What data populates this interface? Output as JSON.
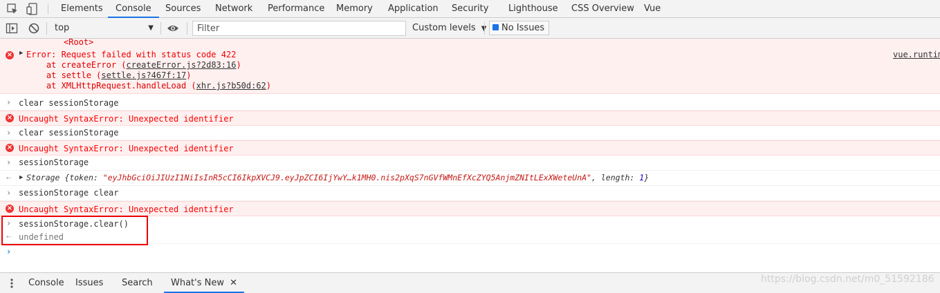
{
  "tabs": [
    {
      "label": "Elements",
      "active": false
    },
    {
      "label": "Console",
      "active": true
    },
    {
      "label": "Sources",
      "active": false
    },
    {
      "label": "Network",
      "active": false
    },
    {
      "label": "Performance",
      "active": false
    },
    {
      "label": "Memory",
      "active": false
    },
    {
      "label": "Application",
      "active": false
    },
    {
      "label": "Security",
      "active": false
    },
    {
      "label": "Lighthouse",
      "active": false
    },
    {
      "label": "CSS Overview",
      "active": false
    },
    {
      "label": "Vue",
      "active": false
    }
  ],
  "toolbar": {
    "context": "top",
    "filter_placeholder": "Filter",
    "levels": "Custom levels",
    "issues": "No Issues"
  },
  "console": {
    "root_tag": "<Root>",
    "error1": {
      "title": "Error: Request failed with status code 422",
      "source": "vue.runtim",
      "stack": [
        {
          "prefix": "    at createError (",
          "link": "createError.js?2d83:16",
          "suffix": ")"
        },
        {
          "prefix": "    at settle (",
          "link": "settle.js?467f:17",
          "suffix": ")"
        },
        {
          "prefix": "    at XMLHttpRequest.handleLoad (",
          "link": "xhr.js?b50d:62",
          "suffix": ")"
        }
      ]
    },
    "input1": "clear sessionStorage",
    "syntax_error": "Uncaught SyntaxError: Unexpected identifier",
    "input2": "clear sessionStorage",
    "input3": "sessionStorage",
    "storage_result": {
      "label": "Storage",
      "open": " {token: ",
      "token": "\"eyJhbGciOiJIUzI1NiIsInR5cCI6IkpXVCJ9.eyJpZCI6IjYwY…k1MH0.nis2pXqS7nGVfWMnEfXcZYQ5AnjmZNItLExXWeteUnA\"",
      "middle": ", length: ",
      "length": "1",
      "close": "}"
    },
    "input4": "sessionStorage clear",
    "input5": "sessionStorage.clear()",
    "result5": "undefined"
  },
  "drawer": [
    {
      "label": "Console",
      "active": false
    },
    {
      "label": "Issues",
      "active": false
    },
    {
      "label": "Search",
      "active": false
    },
    {
      "label": "What's New",
      "active": true
    }
  ],
  "watermark": "https://blog.csdn.net/m0_51592186",
  "colors": {
    "accent": "#1a73e8",
    "error": "#ff0000",
    "error_bg": "#fff0f0"
  }
}
